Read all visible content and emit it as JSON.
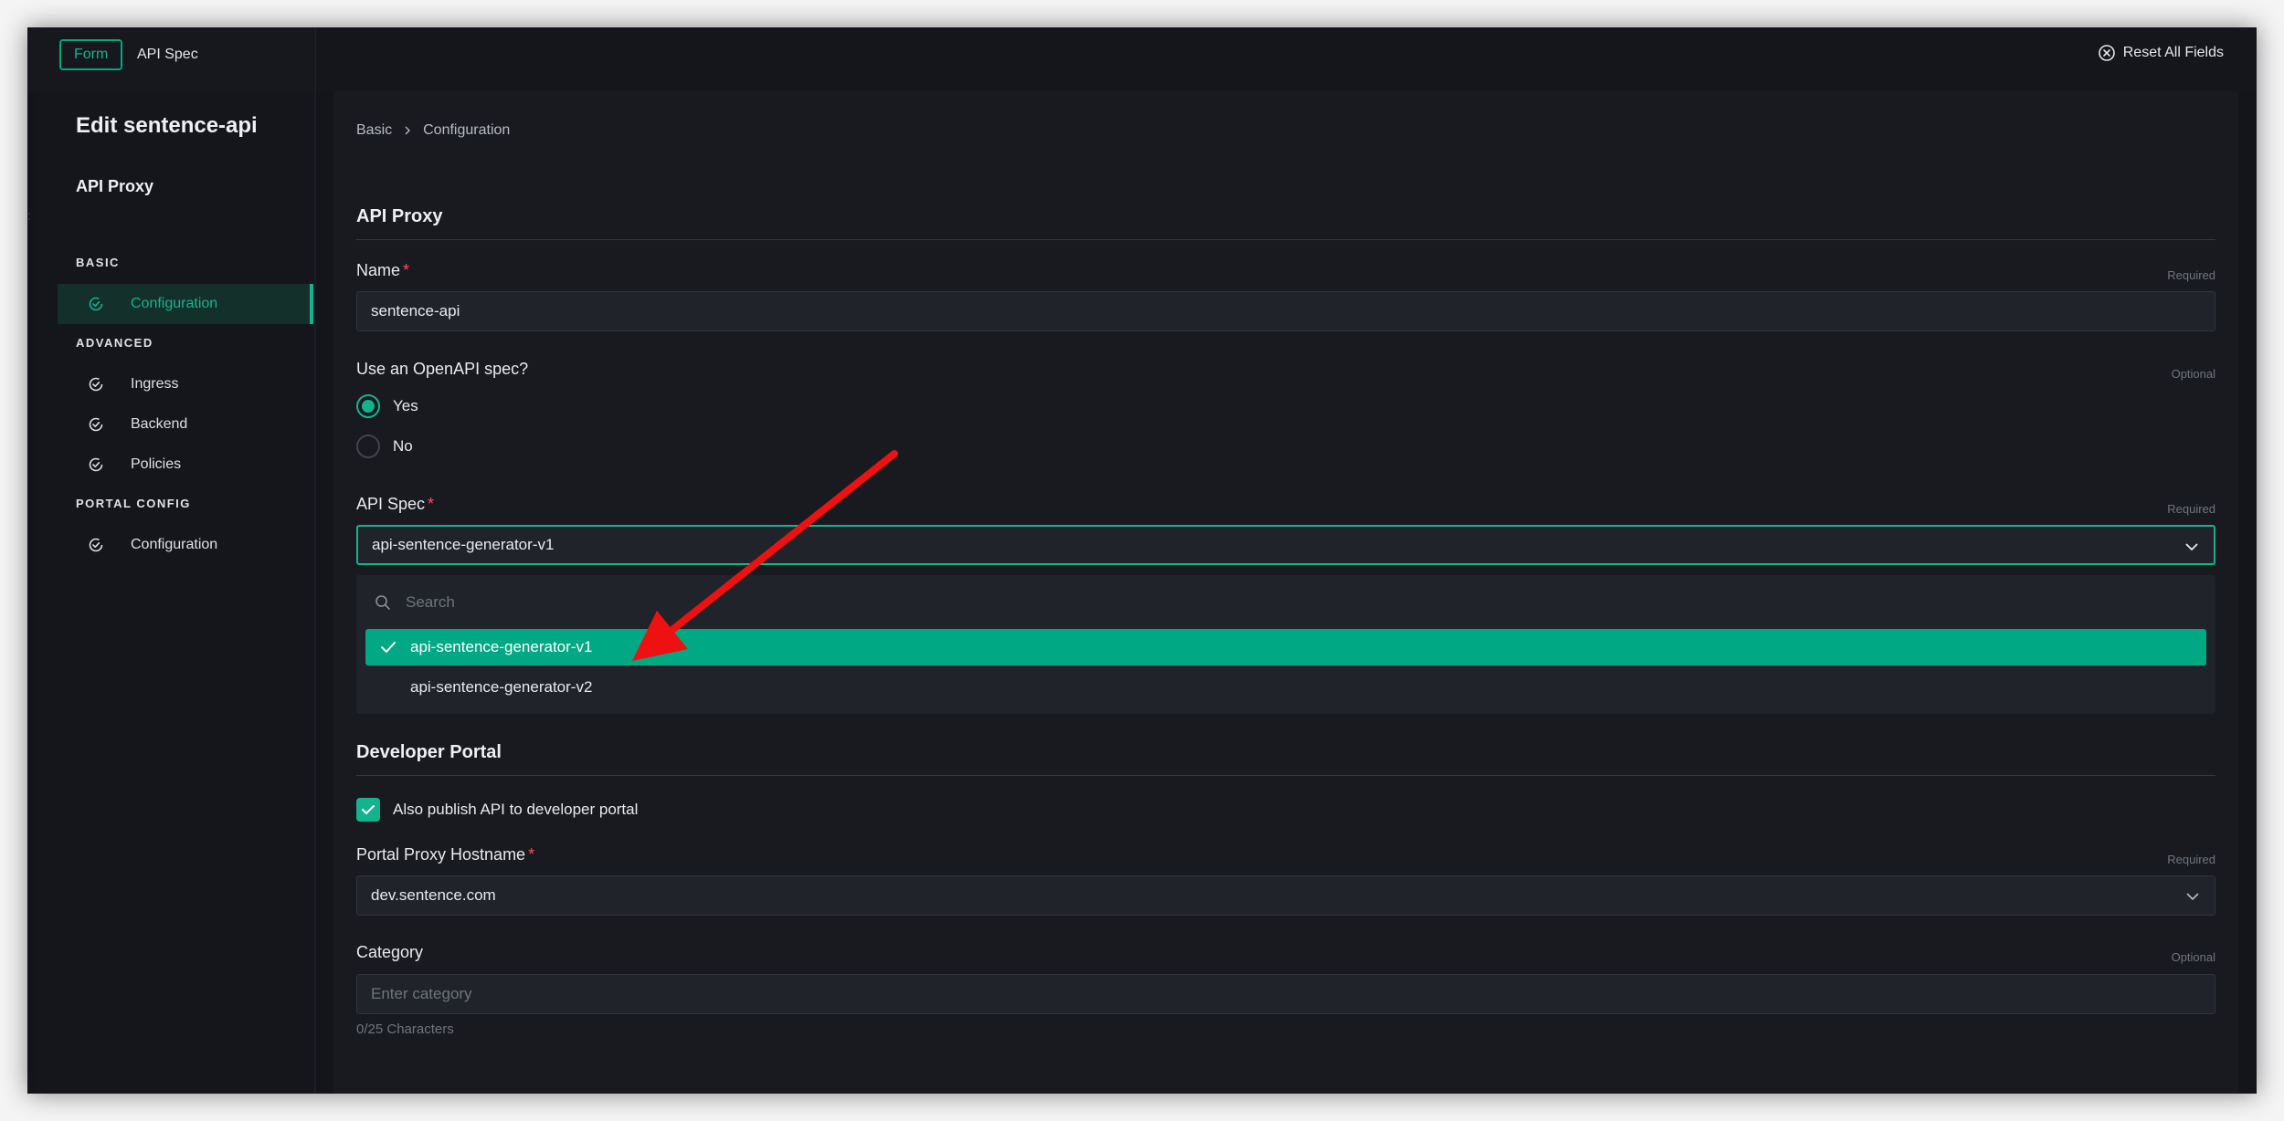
{
  "topbar": {
    "tab_form": "Form",
    "tab_api_spec": "API Spec",
    "reset_label": "Reset All Fields"
  },
  "sidebar": {
    "title": "Edit sentence-api",
    "subtitle": "API Proxy",
    "sections": [
      {
        "label": "BASIC"
      },
      {
        "label": "ADVANCED"
      },
      {
        "label": "PORTAL CONFIG"
      }
    ],
    "items": [
      {
        "label": "Configuration",
        "icon": "check-circle-icon",
        "active": true
      },
      {
        "label": "Ingress",
        "icon": "check-circle-icon"
      },
      {
        "label": "Backend",
        "icon": "check-circle-icon"
      },
      {
        "label": "Policies",
        "icon": "check-circle-icon"
      },
      {
        "label": "Configuration",
        "icon": "check-circle-icon"
      }
    ]
  },
  "breadcrumb": {
    "items": [
      "Basic",
      "Configuration"
    ]
  },
  "api_proxy": {
    "title": "API Proxy",
    "name_label": "Name",
    "name_hint": "Required",
    "name_value": "sentence-api",
    "openapi_label": "Use an OpenAPI spec?",
    "openapi_hint": "Optional",
    "radio_yes": "Yes",
    "radio_no": "No",
    "radio_selected": "Yes",
    "spec_label": "API Spec",
    "spec_hint": "Required",
    "spec_value": "api-sentence-generator-v1",
    "search_placeholder": "Search",
    "options": [
      "api-sentence-generator-v1",
      "api-sentence-generator-v2"
    ],
    "selected_option": "api-sentence-generator-v1"
  },
  "developer_portal": {
    "title": "Developer Portal",
    "publish_label": "Also publish API to developer portal",
    "publish_checked": true,
    "hostname_label": "Portal Proxy Hostname",
    "hostname_hint": "Required",
    "hostname_value": "dev.sentence.com",
    "category_label": "Category",
    "category_hint": "Optional",
    "category_placeholder": "Enter category",
    "category_counter": "0/25 Characters"
  },
  "colors": {
    "accent": "#14b38e",
    "selected_option_bg": "#00a884",
    "required_star": "#ff4d4f",
    "annotation_arrow": "#ee1111",
    "background": "#13151a"
  }
}
